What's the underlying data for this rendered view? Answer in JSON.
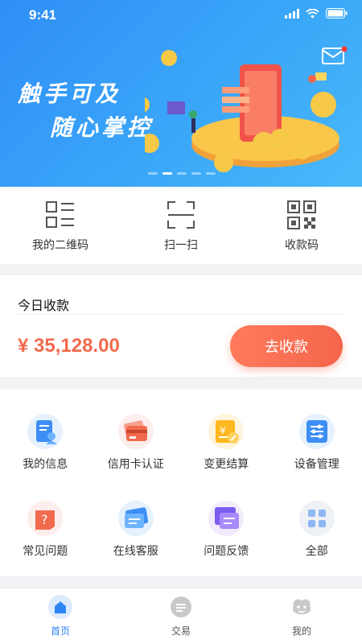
{
  "status": {
    "time": "9:41"
  },
  "banner": {
    "slogan_line1": "触手可及",
    "slogan_line2": "随心掌控",
    "carousel_count": 5,
    "carousel_active": 1
  },
  "quick_actions": [
    {
      "label": "我的二维码",
      "icon": "qr-list-icon"
    },
    {
      "label": "扫一扫",
      "icon": "scan-icon"
    },
    {
      "label": "收款码",
      "icon": "qr-code-icon"
    }
  ],
  "today": {
    "title": "今日收款",
    "amount": "¥ 35,128.00",
    "button_label": "去收款"
  },
  "services": [
    {
      "label": "我的信息",
      "icon": "user-info-icon"
    },
    {
      "label": "信用卡认证",
      "icon": "credit-card-icon"
    },
    {
      "label": "变更结算",
      "icon": "settlement-icon"
    },
    {
      "label": "设备管理",
      "icon": "device-settings-icon"
    },
    {
      "label": "常见问题",
      "icon": "faq-icon"
    },
    {
      "label": "在线客服",
      "icon": "customer-service-icon"
    },
    {
      "label": "问题反馈",
      "icon": "feedback-icon"
    },
    {
      "label": "全部",
      "icon": "all-apps-icon"
    }
  ],
  "tabs": [
    {
      "label": "首页",
      "icon": "home-icon",
      "active": true
    },
    {
      "label": "交易",
      "icon": "transaction-icon",
      "active": false
    },
    {
      "label": "我的",
      "icon": "profile-icon",
      "active": false
    }
  ],
  "colors": {
    "accent": "#2e86f4",
    "amount": "#f26a4d",
    "button": "#f4664b"
  }
}
